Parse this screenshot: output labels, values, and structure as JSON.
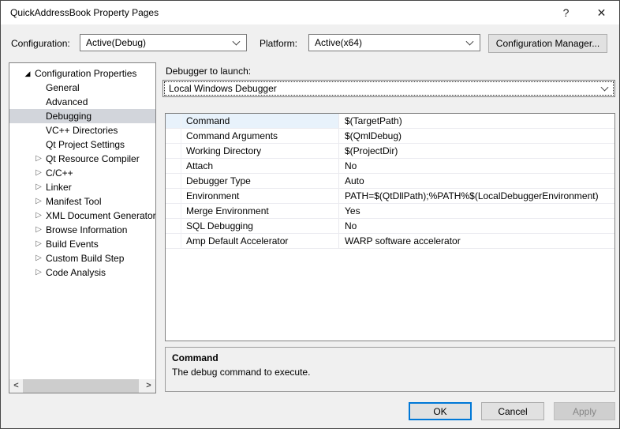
{
  "window": {
    "title": "QuickAddressBook Property Pages"
  },
  "icons": {
    "help": "?",
    "close": "✕",
    "expanded_glyph": "◢",
    "collapsed_glyph": "▷",
    "scroll_left": "<",
    "scroll_right": ">",
    "chevron_down": "css-angle-shape"
  },
  "config_bar": {
    "configuration_label": "Configuration:",
    "configuration_value": "Active(Debug)",
    "platform_label": "Platform:",
    "platform_value": "Active(x64)",
    "manager_button": "Configuration Manager..."
  },
  "tree": {
    "items": [
      {
        "label": "Configuration Properties",
        "level": 0,
        "expander": "expanded",
        "selected": false
      },
      {
        "label": "General",
        "level": 1,
        "expander": "none",
        "selected": false
      },
      {
        "label": "Advanced",
        "level": 1,
        "expander": "none",
        "selected": false
      },
      {
        "label": "Debugging",
        "level": 1,
        "expander": "none",
        "selected": true
      },
      {
        "label": "VC++ Directories",
        "level": 1,
        "expander": "none",
        "selected": false
      },
      {
        "label": "Qt Project Settings",
        "level": 1,
        "expander": "none",
        "selected": false
      },
      {
        "label": "Qt Resource Compiler",
        "level": 1,
        "expander": "collapsed",
        "selected": false
      },
      {
        "label": "C/C++",
        "level": 1,
        "expander": "collapsed",
        "selected": false
      },
      {
        "label": "Linker",
        "level": 1,
        "expander": "collapsed",
        "selected": false
      },
      {
        "label": "Manifest Tool",
        "level": 1,
        "expander": "collapsed",
        "selected": false
      },
      {
        "label": "XML Document Generator",
        "level": 1,
        "expander": "collapsed",
        "selected": false
      },
      {
        "label": "Browse Information",
        "level": 1,
        "expander": "collapsed",
        "selected": false
      },
      {
        "label": "Build Events",
        "level": 1,
        "expander": "collapsed",
        "selected": false
      },
      {
        "label": "Custom Build Step",
        "level": 1,
        "expander": "collapsed",
        "selected": false
      },
      {
        "label": "Code Analysis",
        "level": 1,
        "expander": "collapsed",
        "selected": false
      }
    ]
  },
  "debugger": {
    "label": "Debugger to launch:",
    "value": "Local Windows Debugger"
  },
  "properties": {
    "rows": [
      {
        "name": "Command",
        "value": "$(TargetPath)",
        "selected": true
      },
      {
        "name": "Command Arguments",
        "value": "$(QmlDebug)",
        "selected": false
      },
      {
        "name": "Working Directory",
        "value": "$(ProjectDir)",
        "selected": false
      },
      {
        "name": "Attach",
        "value": "No",
        "selected": false
      },
      {
        "name": "Debugger Type",
        "value": "Auto",
        "selected": false
      },
      {
        "name": "Environment",
        "value": "PATH=$(QtDllPath);%PATH%$(LocalDebuggerEnvironment)",
        "selected": false
      },
      {
        "name": "Merge Environment",
        "value": "Yes",
        "selected": false
      },
      {
        "name": "SQL Debugging",
        "value": "No",
        "selected": false
      },
      {
        "name": "Amp Default Accelerator",
        "value": "WARP software accelerator",
        "selected": false
      }
    ]
  },
  "description": {
    "title": "Command",
    "text": "The debug command to execute."
  },
  "footer": {
    "ok": "OK",
    "cancel": "Cancel",
    "apply": "Apply"
  },
  "colors": {
    "accent": "#0078D7",
    "dialog_bg": "#F0F0F0",
    "titlebar_bg": "#FFFFFF",
    "tree_selection": "#D2D5DB",
    "grid_row_highlight": "#E8F2FB",
    "disabled_text": "#868686"
  }
}
